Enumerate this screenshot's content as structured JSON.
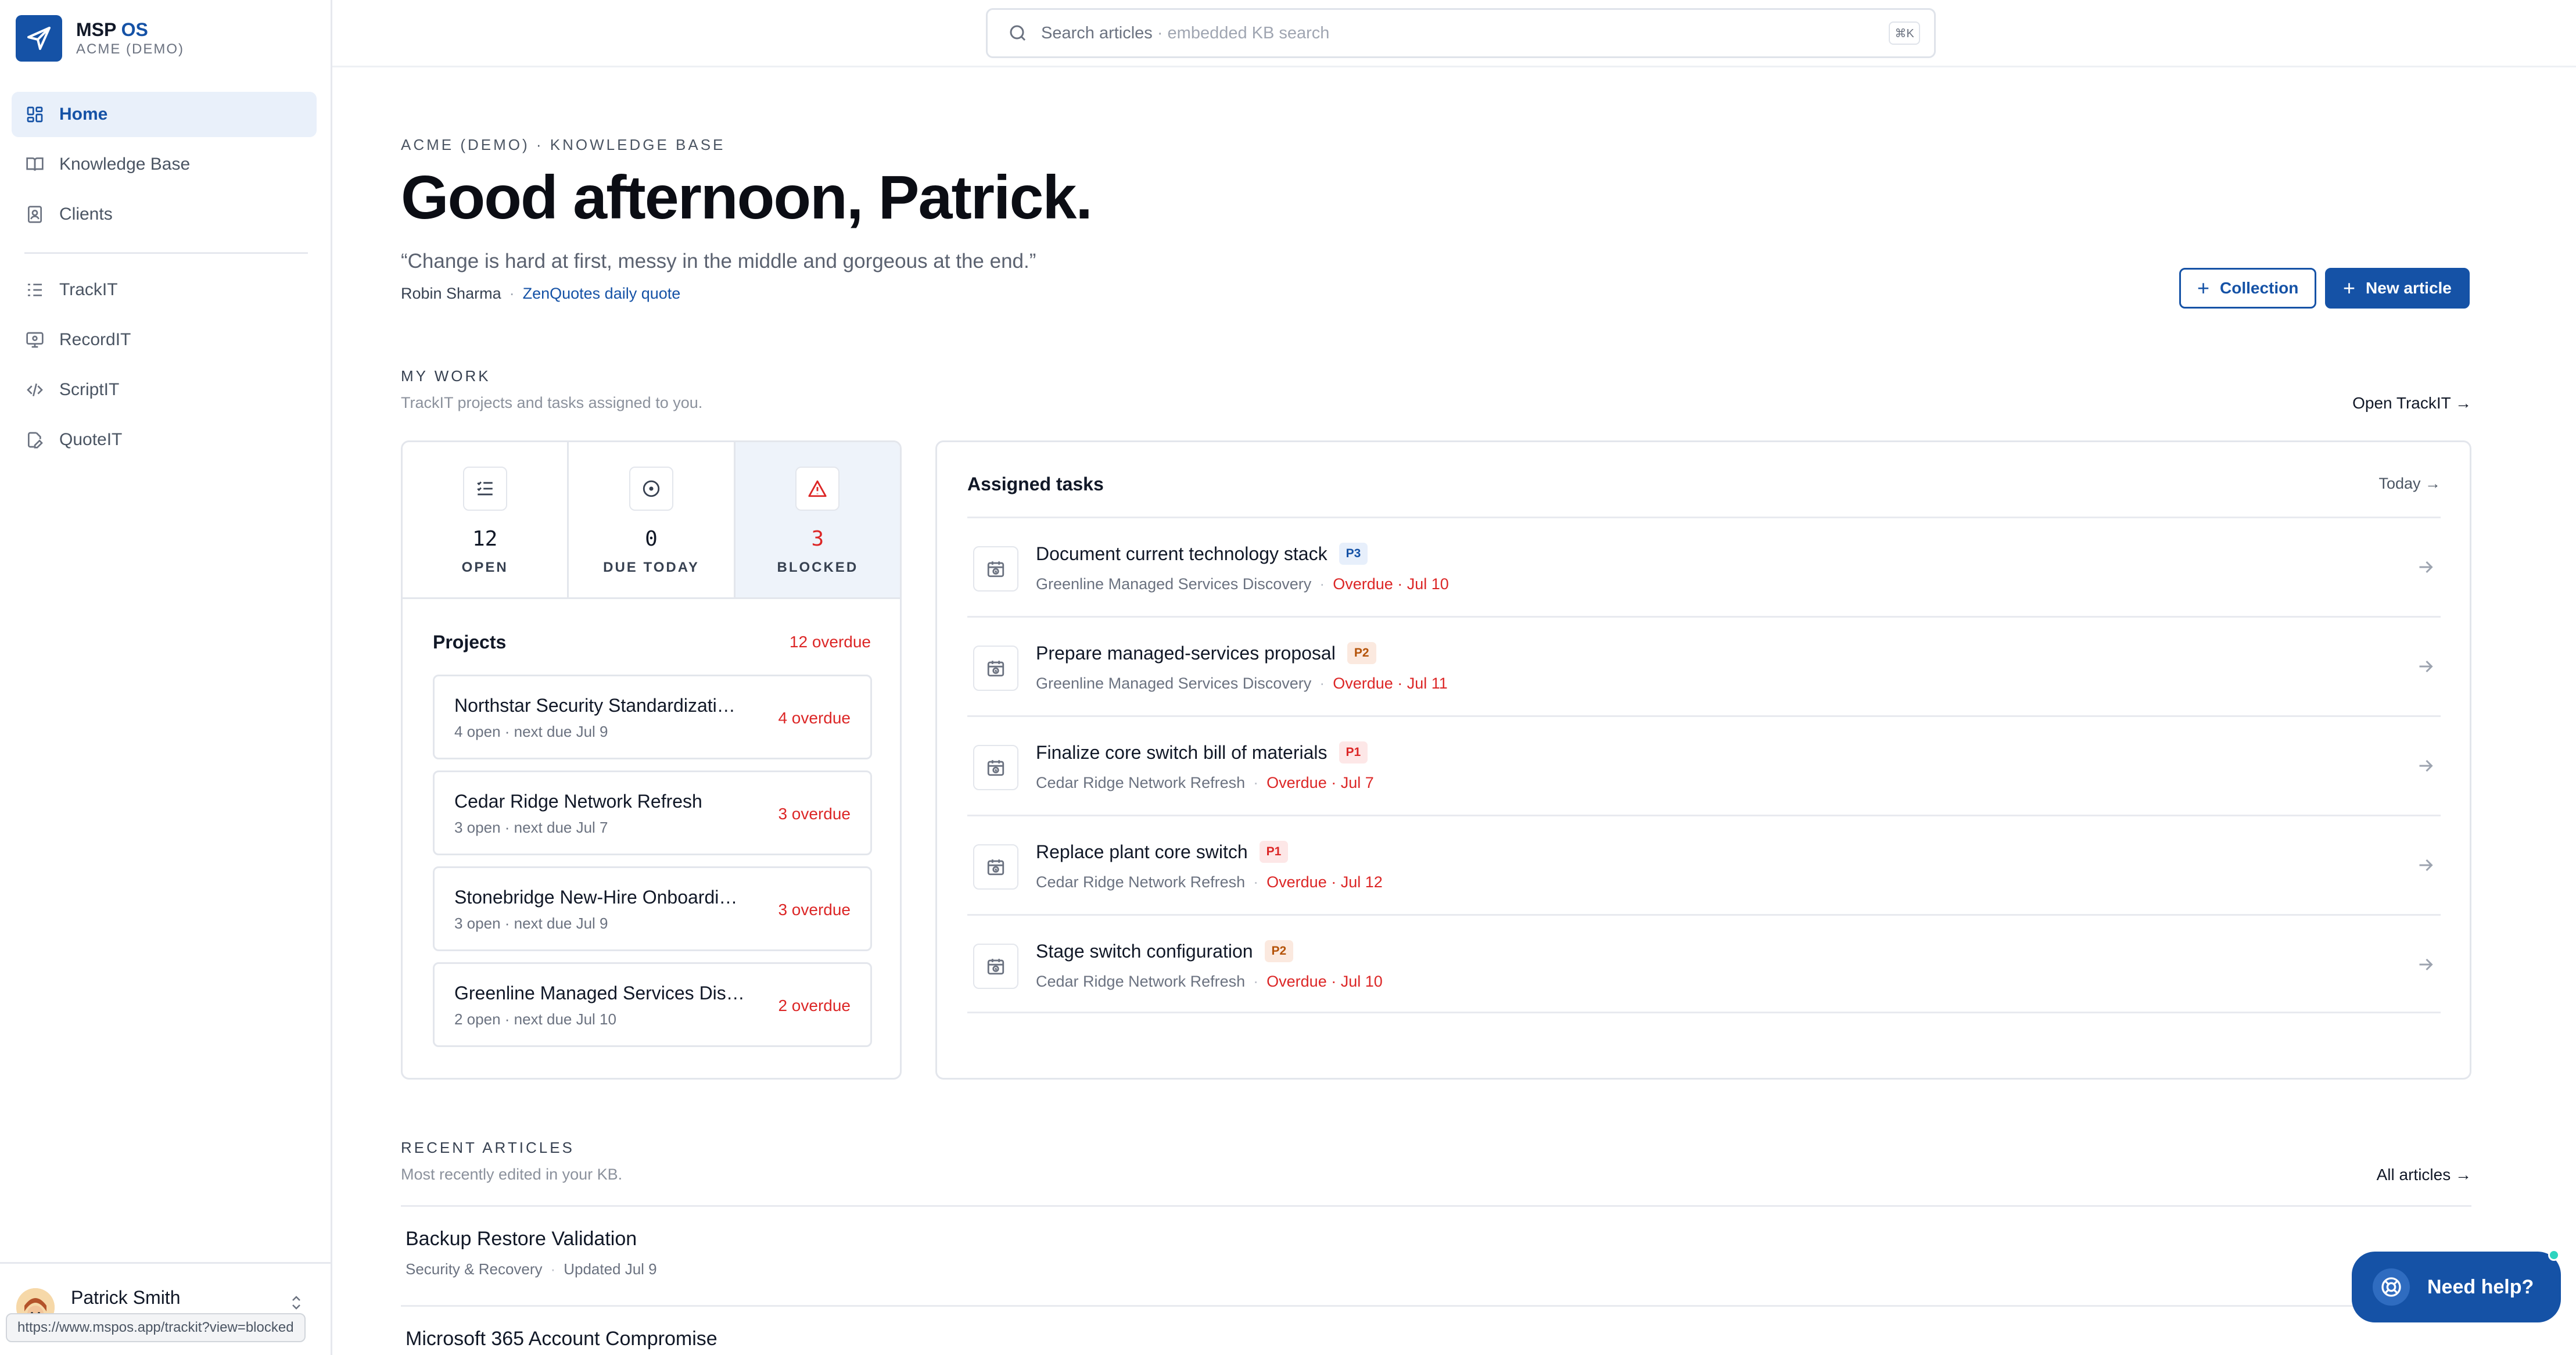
{
  "brand": {
    "name": "MSP",
    "name_accent": "OS",
    "tenant": "ACME (DEMO)"
  },
  "sidebar": {
    "primary": [
      {
        "label": "Home",
        "icon": "grid-icon",
        "active": true
      },
      {
        "label": "Knowledge Base",
        "icon": "book-icon",
        "active": false
      },
      {
        "label": "Clients",
        "icon": "contacts-icon",
        "active": false
      }
    ],
    "secondary": [
      {
        "label": "TrackIT",
        "icon": "checklist-icon"
      },
      {
        "label": "RecordIT",
        "icon": "monitor-icon"
      },
      {
        "label": "ScriptIT",
        "icon": "code-icon"
      },
      {
        "label": "QuoteIT",
        "icon": "document-edit-icon"
      }
    ],
    "user": {
      "name": "Patrick Smith"
    },
    "status_url": "https://www.mspos.app/trackit?view=blocked"
  },
  "search": {
    "placeholder": "Search articles",
    "hint": "· embedded KB search",
    "shortcut": "⌘K"
  },
  "header": {
    "eyebrow": "ACME (DEMO) · KNOWLEDGE BASE",
    "greeting": "Good afternoon, Patrick.",
    "quote": "“Change is hard at first, messy in the middle and gorgeous at the end.”",
    "quote_author": "Robin Sharma",
    "quote_source": "ZenQuotes daily quote",
    "btn_collection": "Collection",
    "btn_new_article": "New article"
  },
  "my_work": {
    "title": "MY WORK",
    "subtitle": "TrackIT projects and tasks assigned to you.",
    "link": "Open TrackIT →",
    "stats": [
      {
        "value": "12",
        "label": "OPEN",
        "icon": "checklist-icon"
      },
      {
        "value": "0",
        "label": "DUE TODAY",
        "icon": "clock-icon"
      },
      {
        "value": "3",
        "label": "BLOCKED",
        "icon": "warning-icon"
      }
    ],
    "projects_title": "Projects",
    "projects_overdue": "12 overdue",
    "projects": [
      {
        "name": "Northstar Security Standardizati…",
        "meta": "4 open · next due Jul 9",
        "overdue": "4 overdue"
      },
      {
        "name": "Cedar Ridge Network Refresh",
        "meta": "3 open · next due Jul 7",
        "overdue": "3 overdue"
      },
      {
        "name": "Stonebridge New-Hire Onboardi…",
        "meta": "3 open · next due Jul 9",
        "overdue": "3 overdue"
      },
      {
        "name": "Greenline Managed Services Dis…",
        "meta": "2 open · next due Jul 10",
        "overdue": "2 overdue"
      }
    ],
    "tasks_title": "Assigned tasks",
    "tasks_link": "Today →",
    "tasks": [
      {
        "title": "Document current technology stack",
        "priority": "P3",
        "project": "Greenline Managed Services Discovery",
        "due": "Overdue · Jul 10"
      },
      {
        "title": "Prepare managed-services proposal",
        "priority": "P2",
        "project": "Greenline Managed Services Discovery",
        "due": "Overdue · Jul 11"
      },
      {
        "title": "Finalize core switch bill of materials",
        "priority": "P1",
        "project": "Cedar Ridge Network Refresh",
        "due": "Overdue · Jul 7"
      },
      {
        "title": "Replace plant core switch",
        "priority": "P1",
        "project": "Cedar Ridge Network Refresh",
        "due": "Overdue · Jul 12"
      },
      {
        "title": "Stage switch configuration",
        "priority": "P2",
        "project": "Cedar Ridge Network Refresh",
        "due": "Overdue · Jul 10"
      }
    ]
  },
  "recent": {
    "title": "RECENT ARTICLES",
    "subtitle": "Most recently edited in your KB.",
    "link": "All articles →",
    "articles": [
      {
        "title": "Backup Restore Validation",
        "category": "Security & Recovery",
        "updated": "Updated Jul 9"
      },
      {
        "title": "Microsoft 365 Account Compromise",
        "category": "",
        "updated": ""
      }
    ]
  },
  "help": {
    "label": "Need help?"
  },
  "colors": {
    "brand": "#1552a6",
    "danger": "#dc2626",
    "p2": "#b45309",
    "text": "#111827"
  }
}
